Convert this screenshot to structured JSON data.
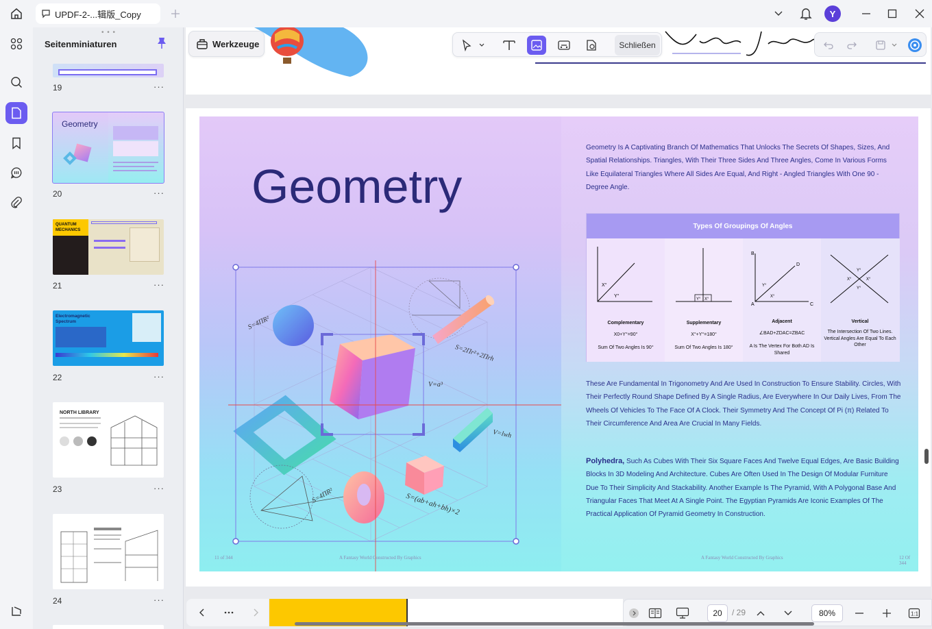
{
  "titlebar": {
    "tab_title": "UPDF-2-...辑版_Copy",
    "avatar_letter": "Y"
  },
  "sidebar_rail": {
    "items": [
      "thumbnails-icon",
      "search-icon",
      "pages-icon",
      "bookmark-icon",
      "comments-icon",
      "attachment-icon",
      "layers-icon"
    ]
  },
  "thumbnails": {
    "heading": "Seitenminiaturen",
    "pages": [
      {
        "num": "19"
      },
      {
        "num": "20",
        "label": "Geometry"
      },
      {
        "num": "21",
        "label": "QUANTUM MECHANICS"
      },
      {
        "num": "22",
        "label": "Electromagnetic Spectrum"
      },
      {
        "num": "23",
        "label": "NORTH LIBRARY"
      },
      {
        "num": "24"
      }
    ]
  },
  "toolbar": {
    "werkzeuge_label": "Werkzeuge",
    "close_label": "Schließen"
  },
  "page": {
    "title": "Geometry",
    "intro": "Geometry Is A Captivating Branch Of Mathematics That Unlocks The Secrets Of Shapes, Sizes, And Spatial Relationships. Triangles, With Their Three Sides And Three Angles, Come In Various Forms Like Equilateral Triangles Where All Sides Are Equal, And Right - Angled Triangles With One 90 - Degree Angle.",
    "angles_heading": "Types Of Groupings Of Angles",
    "angles": [
      {
        "name": "Complementary",
        "desc": "X0+Y°=90°\nSum Of Two Angles Is 90°"
      },
      {
        "name": "Supplementary",
        "desc": "X°+Y°=180°\nSum Of Two Angles Is 180°"
      },
      {
        "name": "Adjacent",
        "desc": "∠BAD+ZDAC=ZBAC\nA Is The Vertex For Both AD Is Shared"
      },
      {
        "name": "Vertical",
        "desc": "The Intersection Of Two Lines. Vertical Angles Are Equal To Each Other"
      }
    ],
    "para2": "These Are Fundamental In Trigonometry And Are Used In Construction To Ensure Stability. Circles, With Their Perfectly Round Shape Defined By A Single Radius, Are Everywhere In Our Daily Lives, From The Wheels Of Vehicles To The Face Of A Clock. Their Symmetry And The Concept Of Pi (π) Related To Their Circumference And Area Are Crucial In Many Fields.",
    "poly_bold": "Polyhedra,",
    "poly_text": " Such As Cubes With Their Six Square Faces And Twelve Equal Edges, Are Basic Building Blocks In 3D Modeling And Architecture. Cubes Are Often Used In The Design Of Modular Furniture Due To Their Simplicity And Stackability. Another Example Is The Pyramid, With A Polygonal Base And Triangular Faces That Meet At A Single Point. The Egyptian Pyramids Are Iconic Examples Of The Practical Application Of Pyramid Geometry In Construction.",
    "footer_left_num": "11 of 344",
    "footer_left": "A Fantasy World Constructed By Graphics",
    "footer_right": "A Fantasy World Constructed By Graphics",
    "footer_right_num": "12 Of 344",
    "formulas": {
      "f1": "S=4ΠR²",
      "f2": "S=2Πr²+2Πrh",
      "f3": "V=a³",
      "f4": "V=lwh",
      "f5": "S=4ΠR²",
      "f6": "S=(ab+ah+bh)×2"
    }
  },
  "bottombar": {
    "current_page": "20",
    "total_pages": "/ 29",
    "zoom": "80%"
  }
}
